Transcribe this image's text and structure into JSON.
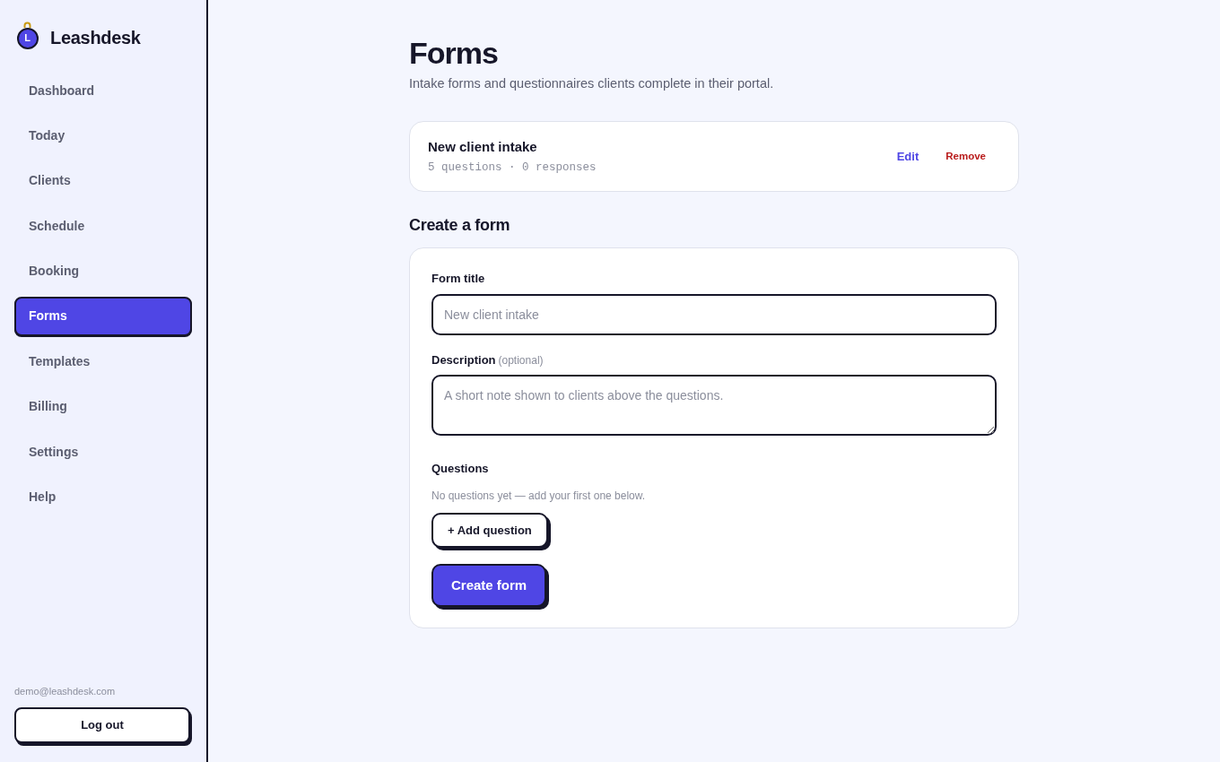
{
  "brand": {
    "name": "Leashdesk",
    "logo_letter": "L"
  },
  "sidebar": {
    "items": [
      {
        "label": "Dashboard",
        "selected": false
      },
      {
        "label": "Today",
        "selected": false
      },
      {
        "label": "Clients",
        "selected": false
      },
      {
        "label": "Schedule",
        "selected": false
      },
      {
        "label": "Booking",
        "selected": false
      },
      {
        "label": "Forms",
        "selected": true
      },
      {
        "label": "Templates",
        "selected": false
      },
      {
        "label": "Billing",
        "selected": false
      },
      {
        "label": "Settings",
        "selected": false
      },
      {
        "label": "Help",
        "selected": false
      }
    ],
    "account_email": "demo@leashdesk.com",
    "logout_button": "Log out"
  },
  "page": {
    "title": "Forms",
    "subtitle": "Intake forms and questionnaires clients complete in their portal."
  },
  "forms": [
    {
      "title": "New client intake",
      "meta": "5 questions · 0 responses",
      "actions": [
        {
          "label": "Edit",
          "kind": "edit"
        },
        {
          "label": "Remove",
          "kind": "remove"
        }
      ]
    }
  ],
  "create_form": {
    "heading": "Create a form",
    "fields": [
      {
        "kind": "input",
        "label": "Form title",
        "placeholder": "New client intake"
      },
      {
        "kind": "textarea",
        "label": "Description",
        "hint": "(optional)",
        "placeholder": "A short note shown to clients above the questions."
      }
    ],
    "questions": {
      "label": "Questions",
      "empty_text": "No questions yet — add your first one below.",
      "add_button": "+ Add question"
    },
    "submit_button": "Create form"
  }
}
